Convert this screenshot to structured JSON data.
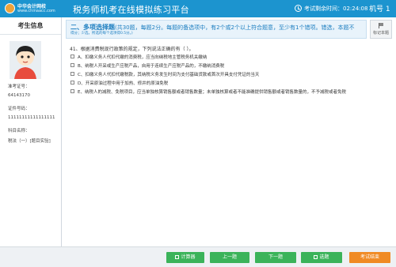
{
  "header": {
    "logo_line1": "中华会计网校",
    "logo_line2": "www.chinaacc.com",
    "title": "税务师机考在线模拟练习平台",
    "timer_label": "考试剩余时间：",
    "timer_value": "02:24:08",
    "machine_label": "机号 1"
  },
  "candidate": {
    "panel_title": "考生信息",
    "ticket_label": "准考证号：",
    "ticket_value": "64143170",
    "id_label": "证件号码：",
    "id_value": "11111111111111111",
    "subject_label": "科目名称：",
    "subject_value": "税法（一）[题目实验]"
  },
  "question_section": {
    "type_title": "二、多项选择题",
    "type_meta": "(共30题，每题2分。每题的备选项中，有2个或2个以上符合题意，至少有1个错项。错选，本题不",
    "desc": "得分；少选，所选的每个选项得0.5分。)",
    "mark_label": "标记本题"
  },
  "question": {
    "number": "41",
    "stem": "41、根据消费税现行政策的规定，下列说法正确的有（  ）。",
    "options": [
      "A、扣缴义务人代扣代缴的消费税，应当向纳税地主管税务机关缴纳",
      "B、纳税人开采或生产应税产品，自用于连续生产应税产品的，不缴纳消费税",
      "C、扣缴义务人代扣代缴税款，其纳税义务发生时间为支付基础货款或首次开具支付凭证的当天",
      "D、开采原油过程中用于加热、修井的原油免税",
      "E、纳税人的减税、免税项目，应当单独核算销售额或者销售数量；未单独核算或者不能准确提供销售额或者销售数量的，不予减税或者免税"
    ]
  },
  "footer": {
    "calc_label": "计算器",
    "prev_label": "上一题",
    "next_label": "下一题",
    "select_label": "选题",
    "end_label": "考试结束"
  },
  "colors": {
    "topbar": "#1c94cf",
    "button_green": "#3bb35a",
    "button_orange": "#f08a24",
    "header_bg": "#e8f3fb"
  },
  "icons": {
    "clock": "clock-icon",
    "flag": "flag-icon",
    "calculator": "calculator-icon",
    "grid": "grid-icon"
  }
}
